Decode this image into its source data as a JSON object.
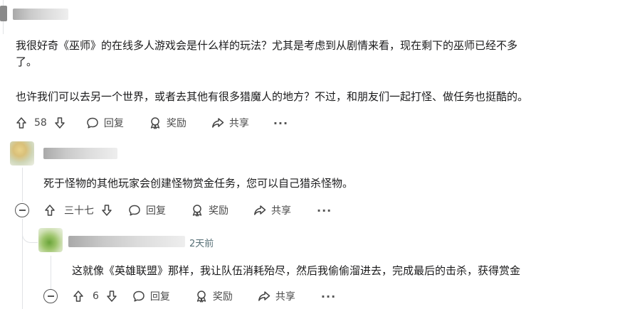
{
  "comment1": {
    "paragraph1_line1": "我很好奇《巫师》的在线多人游戏会是什么样的玩法？尤其是考虑到从剧情来看，现在剩下的巫师已经不多",
    "paragraph1_line2": "了。",
    "paragraph2": "也许我们可以去另一个世界，或者去其他有很多猎魔人的地方？不过，和朋友们一起打怪、做任务也挺酷的。",
    "votes": "58",
    "reply_label": "回复",
    "award_label": "奖励",
    "share_label": "共享",
    "more_label": "···"
  },
  "comment2": {
    "text": "死于怪物的其他玩家会创建怪物赏金任务，您可以自己猎杀怪物。",
    "votes": "三十七",
    "reply_label": "回复",
    "award_label": "奖励",
    "share_label": "共享",
    "more_label": "···"
  },
  "comment3": {
    "time": "2天前",
    "text": "这就像《英雄联盟》那样，我让队伍消耗殆尽，然后我偷偷溜进去，完成最后的击杀，获得赏金",
    "votes": "6",
    "reply_label": "回复",
    "award_label": "奖励",
    "share_label": "共享",
    "more_label": "···"
  }
}
